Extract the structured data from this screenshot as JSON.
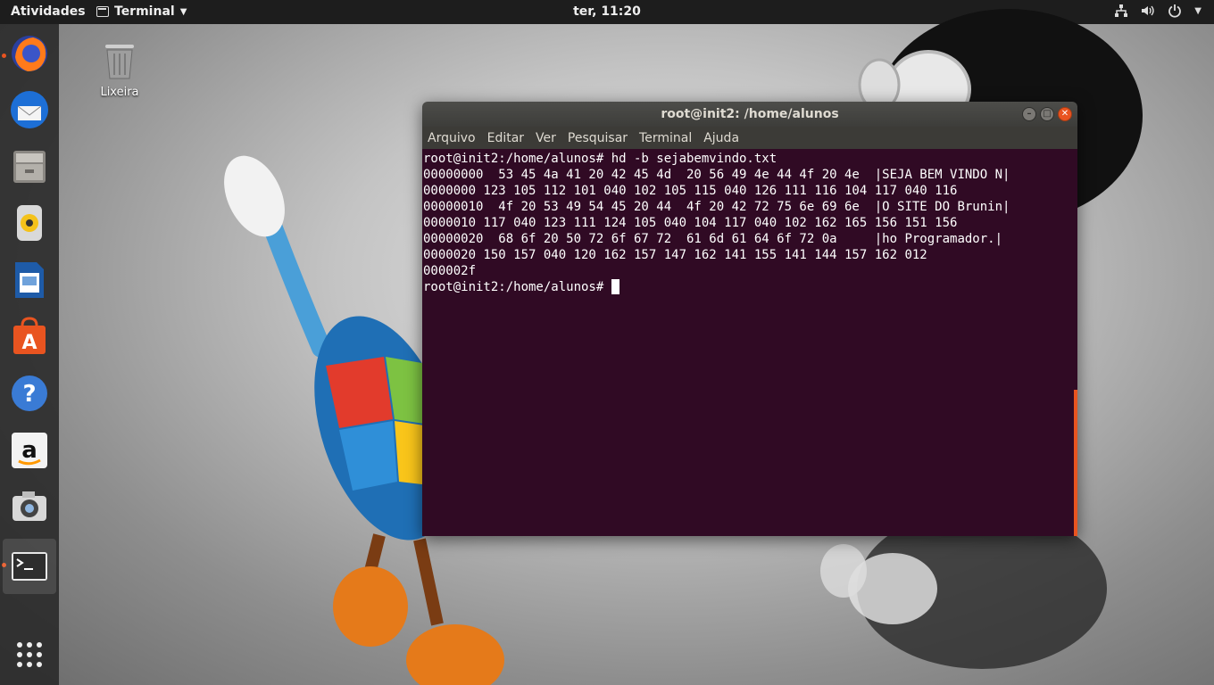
{
  "topbar": {
    "activities": "Atividades",
    "app_name": "Terminal",
    "clock": "ter, 11:20"
  },
  "dock": {
    "items": [
      {
        "name": "Firefox",
        "icon": "firefox-icon",
        "running": true
      },
      {
        "name": "Thunderbird",
        "icon": "thunderbird-icon",
        "running": false
      },
      {
        "name": "Arquivos",
        "icon": "files-icon",
        "running": false
      },
      {
        "name": "Rhythmbox",
        "icon": "rhythmbox-icon",
        "running": false
      },
      {
        "name": "LibreOffice Writer",
        "icon": "writer-icon",
        "running": false
      },
      {
        "name": "Ubuntu Software",
        "icon": "software-icon",
        "running": false
      },
      {
        "name": "Ajuda",
        "icon": "help-icon",
        "running": false
      },
      {
        "name": "Amazon",
        "icon": "amazon-icon",
        "running": false
      },
      {
        "name": "Shotwell",
        "icon": "camera-icon",
        "running": false
      },
      {
        "name": "Terminal",
        "icon": "terminal-icon",
        "running": true
      },
      {
        "name": "Mostrar aplicativos",
        "icon": "app-grid-icon",
        "running": false
      }
    ]
  },
  "desktop": {
    "trash_label": "Lixeira"
  },
  "terminal": {
    "title": "root@init2: /home/alunos",
    "menu": [
      "Arquivo",
      "Editar",
      "Ver",
      "Pesquisar",
      "Terminal",
      "Ajuda"
    ],
    "lines": [
      "root@init2:/home/alunos# hd -b sejabemvindo.txt",
      "00000000  53 45 4a 41 20 42 45 4d  20 56 49 4e 44 4f 20 4e  |SEJA BEM VINDO N|",
      "0000000 123 105 112 101 040 102 105 115 040 126 111 116 104 117 040 116",
      "00000010  4f 20 53 49 54 45 20 44  4f 20 42 72 75 6e 69 6e  |O SITE DO Brunin|",
      "0000010 117 040 123 111 124 105 040 104 117 040 102 162 165 156 151 156",
      "00000020  68 6f 20 50 72 6f 67 72  61 6d 61 64 6f 72 0a     |ho Programador.|",
      "0000020 150 157 040 120 162 157 147 162 141 155 141 144 157 162 012",
      "000002f"
    ],
    "prompt": "root@init2:/home/alunos# "
  },
  "colors": {
    "terminal_bg": "#300a24",
    "accent": "#e95420",
    "topbar_bg": "#1d1d1d"
  }
}
